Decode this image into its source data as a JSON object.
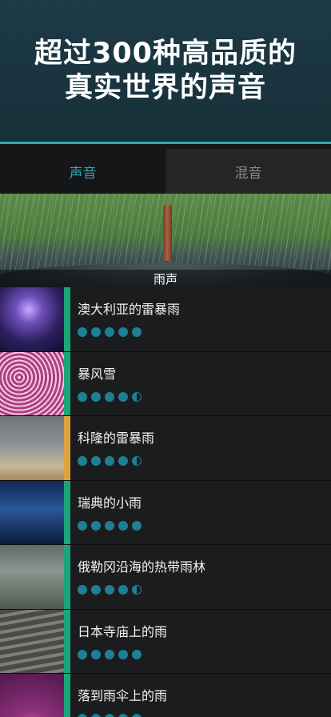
{
  "hero": {
    "line1": "超过300种高品质的",
    "line2": "真实世界的声音"
  },
  "tabs": [
    {
      "label": "声音",
      "active": true
    },
    {
      "label": "混音",
      "active": false
    }
  ],
  "banner": {
    "label": "雨声"
  },
  "sounds": [
    {
      "title": "澳大利亚的雷暴雨",
      "rating": 5,
      "bar": "#1aa57a"
    },
    {
      "title": "暴风雪",
      "rating": 4.5,
      "bar": "#1aa57a"
    },
    {
      "title": "科隆的雷暴雨",
      "rating": 4.5,
      "bar": "#e0a23d"
    },
    {
      "title": "瑞典的小雨",
      "rating": 5,
      "bar": "#1aa57a"
    },
    {
      "title": "俄勒冈沿海的热带雨林",
      "rating": 4.5,
      "bar": "#1aa57a"
    },
    {
      "title": "日本寺庙上的雨",
      "rating": 5,
      "bar": "#1aa57a"
    },
    {
      "title": "落到雨伞上的雨",
      "rating": 5,
      "bar": "#1aa57a"
    }
  ],
  "colors": {
    "accent": "#2aa9c2",
    "rating_dot": "#1e7f95",
    "bar_green": "#1aa57a",
    "bar_gold": "#e0a23d"
  }
}
